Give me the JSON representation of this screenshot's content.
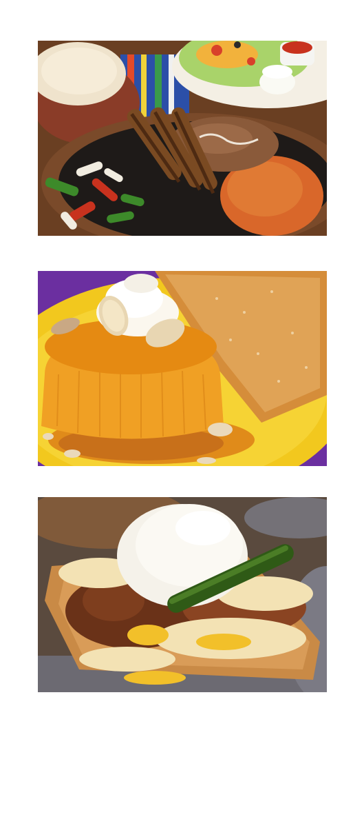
{
  "gallery": {
    "photos": [
      {
        "subject": "fajitas-plate"
      },
      {
        "subject": "flan-dessert"
      },
      {
        "subject": "nachos-sour-cream"
      }
    ]
  },
  "colors": {
    "background": "#ffffff",
    "tortilla": "#efe3cc",
    "rice": "#d9672a",
    "beans": "#8a5a3a",
    "chicken": "#7a4a22",
    "pepper_green": "#3d8a2a",
    "pepper_red": "#c8321e",
    "plate_yellow": "#f2c81e",
    "purple_cloth": "#6b2fa0",
    "flan": "#f0a024",
    "caramel": "#c8701a",
    "cream": "#fbf7ee",
    "cheese": "#f3e2b4",
    "jalapeno": "#2f5a16"
  }
}
